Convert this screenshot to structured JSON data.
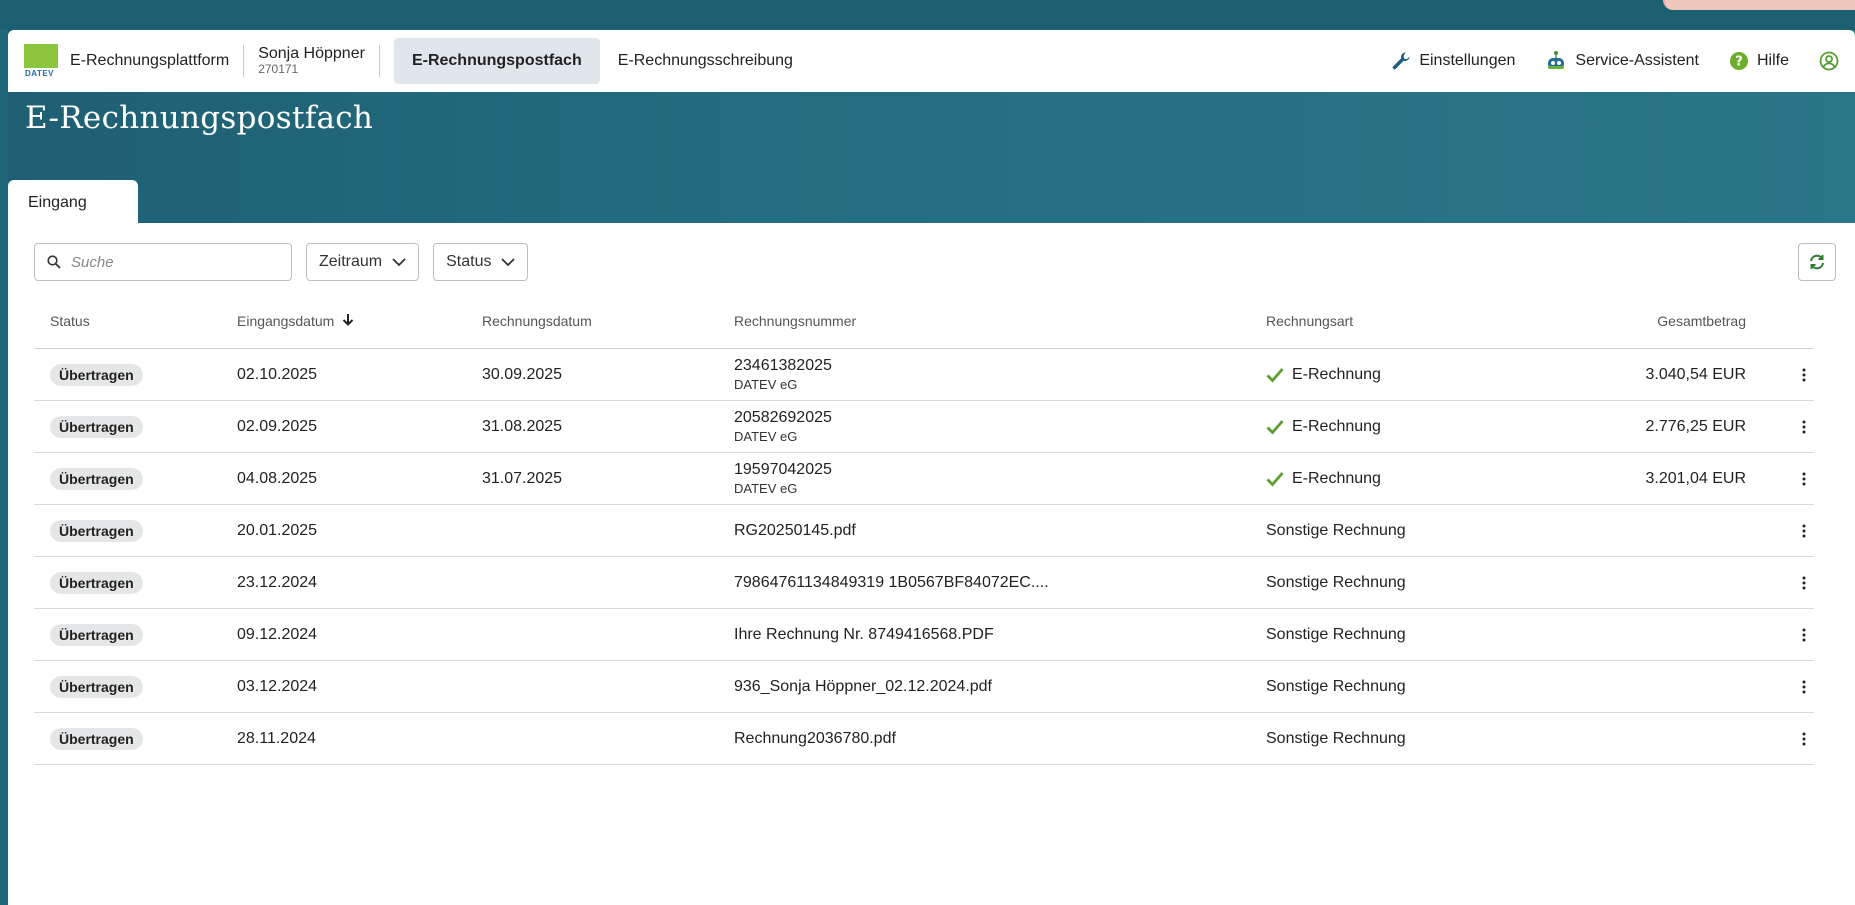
{
  "nav": {
    "logo_text": "DATEV",
    "app_name": "E-Rechnungsplattform",
    "user_name": "Sonja Höppner",
    "user_id": "270171",
    "tabs": [
      {
        "label": "E-Rechnungspostfach",
        "active": true
      },
      {
        "label": "E-Rechnungsschreibung",
        "active": false
      }
    ],
    "links": {
      "settings": "Einstellungen",
      "assistant": "Service-Assistent",
      "help": "Hilfe"
    }
  },
  "page": {
    "title": "E-Rechnungspostfach",
    "tab": "Eingang"
  },
  "toolbar": {
    "search_placeholder": "Suche",
    "period_label": "Zeitraum",
    "status_label": "Status"
  },
  "table": {
    "headers": {
      "status": "Status",
      "received": "Eingangsdatum",
      "invoice_date": "Rechnungsdatum",
      "number": "Rechnungsnummer",
      "type": "Rechnungsart",
      "total": "Gesamtbetrag"
    },
    "rows": [
      {
        "status": "Übertragen",
        "received": "02.10.2025",
        "invoice_date": "30.09.2025",
        "number": "23461382025",
        "sender": "DATEV eG",
        "type": "E-Rechnung",
        "total": "3.040,54 EUR"
      },
      {
        "status": "Übertragen",
        "received": "02.09.2025",
        "invoice_date": "31.08.2025",
        "number": "20582692025",
        "sender": "DATEV eG",
        "type": "E-Rechnung",
        "total": "2.776,25 EUR"
      },
      {
        "status": "Übertragen",
        "received": "04.08.2025",
        "invoice_date": "31.07.2025",
        "number": "19597042025",
        "sender": "DATEV eG",
        "type": "E-Rechnung",
        "total": "3.201,04 EUR"
      },
      {
        "status": "Übertragen",
        "received": "20.01.2025",
        "invoice_date": "",
        "number": "RG20250145.pdf",
        "sender": "",
        "type": "Sonstige Rechnung",
        "total": ""
      },
      {
        "status": "Übertragen",
        "received": "23.12.2024",
        "invoice_date": "",
        "number": "79864761134849319 1B0567BF84072EC....",
        "sender": "",
        "type": "Sonstige Rechnung",
        "total": ""
      },
      {
        "status": "Übertragen",
        "received": "09.12.2024",
        "invoice_date": "",
        "number": "Ihre Rechnung Nr. 8749416568.PDF",
        "sender": "",
        "type": "Sonstige Rechnung",
        "total": ""
      },
      {
        "status": "Übertragen",
        "received": "03.12.2024",
        "invoice_date": "",
        "number": "936_Sonja Höppner_02.12.2024.pdf",
        "sender": "",
        "type": "Sonstige Rechnung",
        "total": ""
      },
      {
        "status": "Übertragen",
        "received": "28.11.2024",
        "invoice_date": "",
        "number": "Rechnung2036780.pdf",
        "sender": "",
        "type": "Sonstige Rechnung",
        "total": ""
      }
    ]
  },
  "colors": {
    "header_bg": "#236d80",
    "logo_green": "#8cc63e",
    "check_green": "#5a9e2f",
    "help_green": "#6cae2c"
  }
}
